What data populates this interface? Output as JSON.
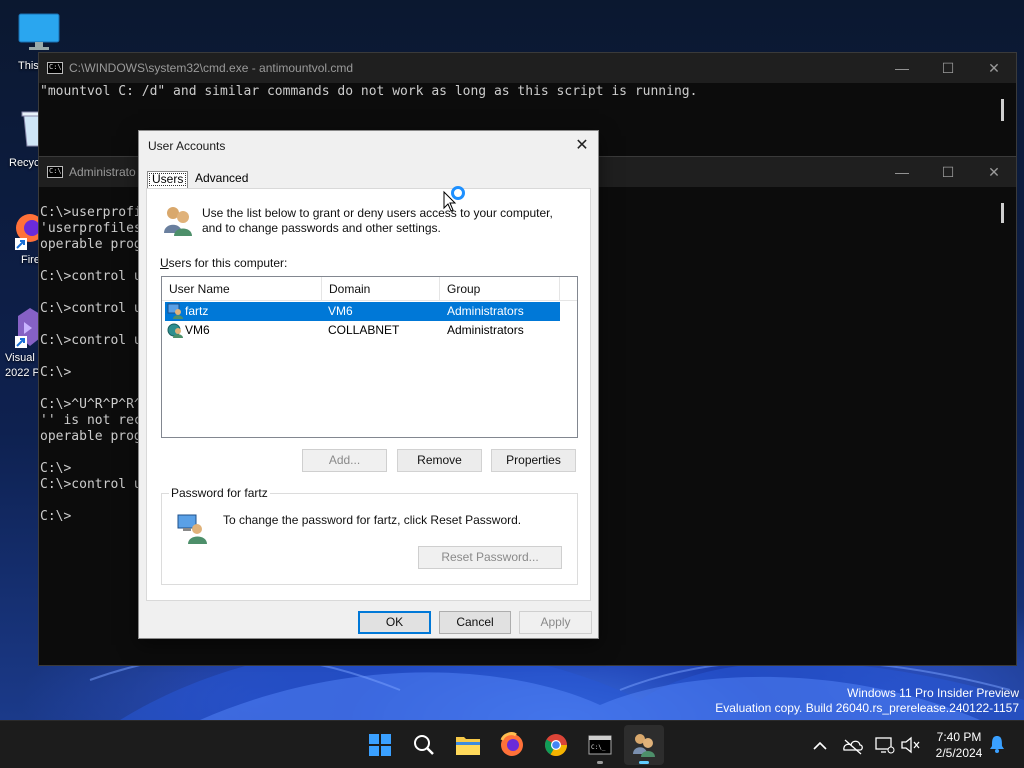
{
  "desktop": {
    "icons": [
      {
        "label": "This",
        "name": "this-pc"
      },
      {
        "label": "Recyc",
        "name": "recycle-bin"
      },
      {
        "label": "Fire",
        "name": "firefox"
      },
      {
        "label": "Visual",
        "label2": "2022 P",
        "name": "visual-studio"
      }
    ],
    "watermark": {
      "line1": "Windows 11 Pro Insider Preview",
      "line2": "Evaluation copy. Build 26040.rs_prerelease.240122-1157"
    }
  },
  "cmd_back": {
    "title": "C:\\WINDOWS\\system32\\cmd.exe - antimountvol.cmd",
    "console_text": "\"mountvol C: /d\" and similar commands do not work as long as this script is running.",
    "controls": {
      "minimize": "—",
      "maximize": "☐",
      "close": "✕"
    }
  },
  "cmd_front": {
    "title": "Administrato",
    "lines": [
      "C:\\>userprofi",
      "'userprofiles",
      "operable prog",
      "",
      "C:\\>control u",
      "",
      "C:\\>control u",
      "",
      "C:\\>control u",
      "",
      "C:\\>",
      "",
      "C:\\>^U^R^P^R^",
      "'' is not rec",
      "operable prog",
      "",
      "C:\\>",
      "C:\\>control u",
      "",
      "C:\\>"
    ],
    "controls": {
      "minimize": "—",
      "maximize": "☐",
      "close": "✕"
    }
  },
  "dialog": {
    "title": "User Accounts",
    "close": "✕",
    "tabs": {
      "users": "Users",
      "advanced": "Advanced"
    },
    "intro_line1": "Use the list below to grant or deny users access to your computer,",
    "intro_line2": "and to change passwords and other settings.",
    "users_label_prefix": "U",
    "users_label_rest": "sers for this computer:",
    "columns": {
      "user_name": "User Name",
      "domain": "Domain",
      "group": "Group"
    },
    "rows": [
      {
        "user": "fartz",
        "domain": "VM6",
        "group": "Administrators",
        "selected": true
      },
      {
        "user": "VM6",
        "domain": "COLLABNET",
        "group": "Administrators",
        "selected": false
      }
    ],
    "buttons": {
      "add": "Add...",
      "remove": "Remove",
      "properties": "Properties"
    },
    "password_group_title": "Password for fartz",
    "password_text": "To change the password for fartz, click Reset Password.",
    "reset_password": "Reset Password...",
    "ok": "OK",
    "cancel": "Cancel",
    "apply": "Apply"
  },
  "taskbar": {
    "apps": [
      {
        "name": "start",
        "active": false
      },
      {
        "name": "search",
        "active": false
      },
      {
        "name": "file-explorer",
        "active": false
      },
      {
        "name": "firefox",
        "active": false
      },
      {
        "name": "chrome",
        "active": false
      },
      {
        "name": "terminal",
        "active": false,
        "running": true
      },
      {
        "name": "user-accounts",
        "active": true,
        "running": true
      }
    ],
    "clock": {
      "time": "7:40 PM",
      "date": "2/5/2024"
    }
  }
}
